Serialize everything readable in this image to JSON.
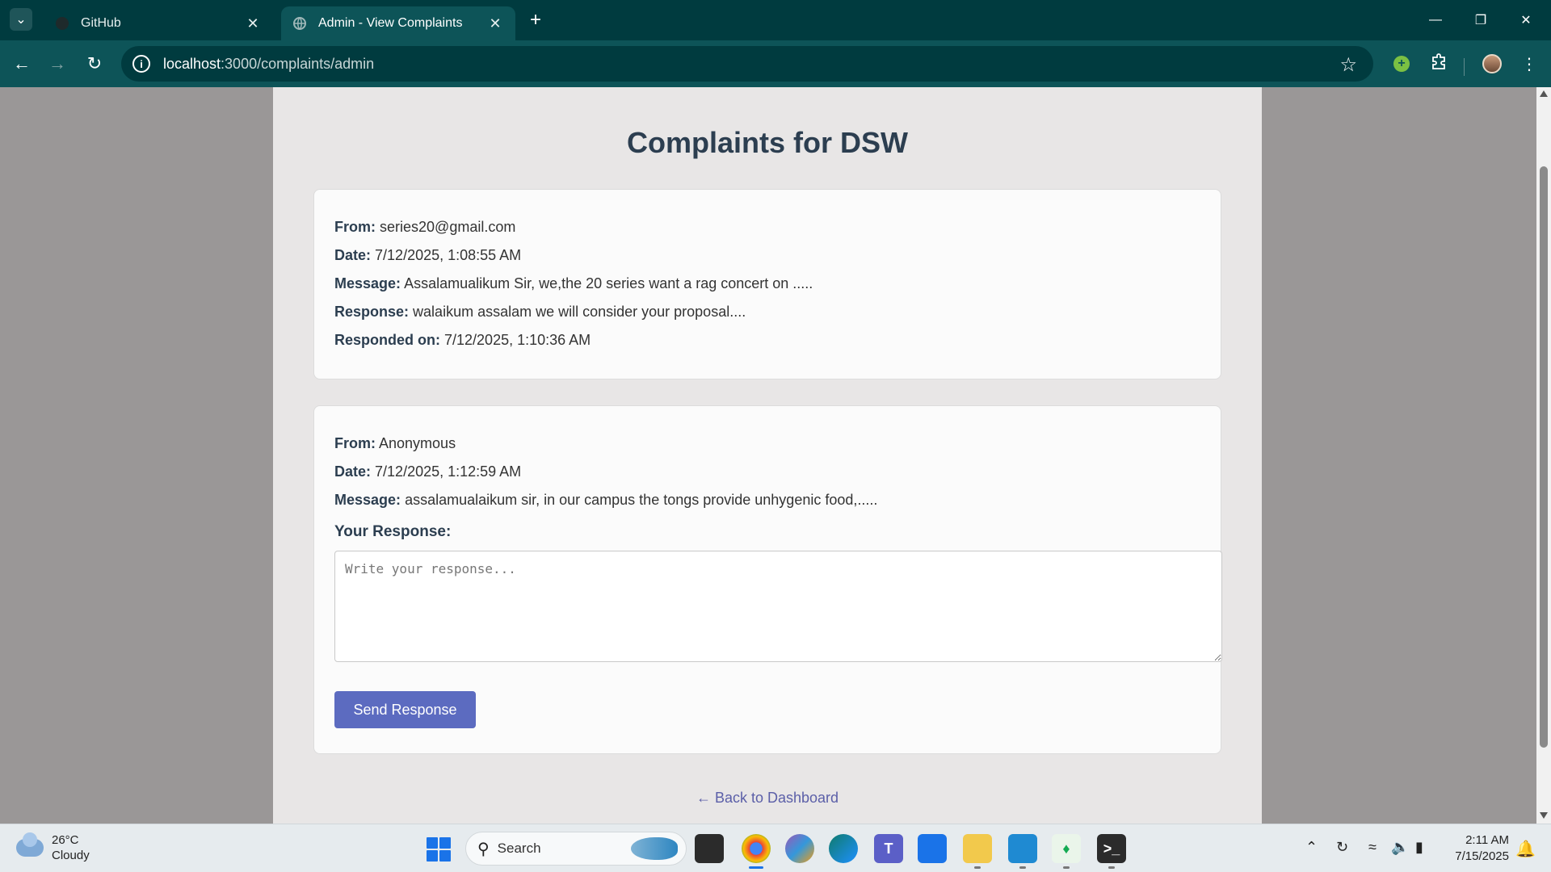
{
  "browser": {
    "tabs": [
      {
        "title": "GitHub",
        "icon": "github-icon"
      },
      {
        "title": "Admin - View Complaints",
        "icon": "globe-icon"
      }
    ],
    "url_host": "localhost",
    "url_path": ":3000/complaints/admin",
    "accent": "#0d5458",
    "tabbar_bg": "#003b3f"
  },
  "page": {
    "title": "Complaints for DSW",
    "labels": {
      "from": "From:",
      "date": "Date:",
      "message": "Message:",
      "response": "Response:",
      "responded_on": "Responded on:",
      "your_response": "Your Response:"
    },
    "complaints": [
      {
        "from": "series20@gmail.com",
        "date": "7/12/2025, 1:08:55 AM",
        "message": "Assalamualikum Sir, we,the 20 series want a rag concert on .....",
        "response": "walaikum assalam we will consider your proposal....",
        "responded_on": "7/12/2025, 1:10:36 AM"
      },
      {
        "from": "Anonymous",
        "date": "7/12/2025, 1:12:59 AM",
        "message": "assalamualaikum sir, in our campus the tongs provide unhygenic food,....."
      }
    ],
    "response_placeholder": "Write your response...",
    "send_button": "Send Response",
    "back_link": "← Back to Dashboard",
    "button_color": "#5c6bc0"
  },
  "taskbar": {
    "weather_temp": "26°C",
    "weather_desc": "Cloudy",
    "search_label": "Search",
    "time": "2:11 AM",
    "date": "7/15/2025"
  }
}
